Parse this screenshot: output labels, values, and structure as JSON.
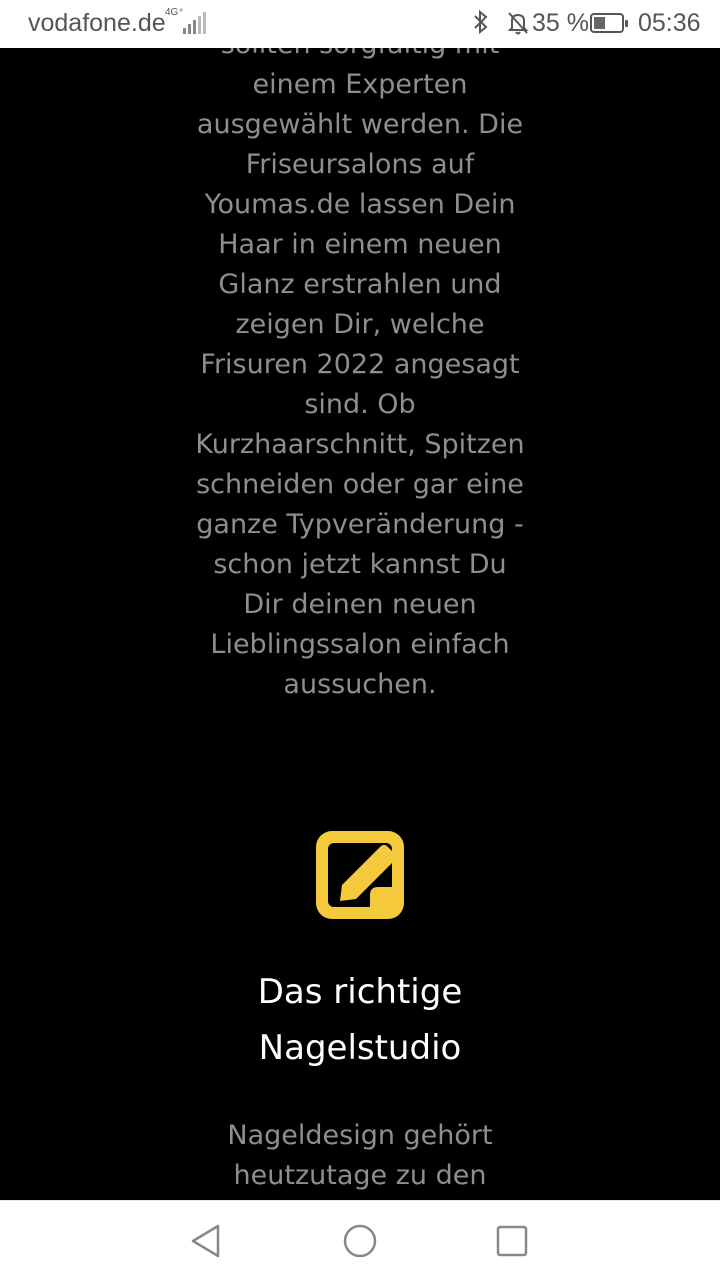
{
  "status_bar": {
    "carrier": "vodafone.de",
    "network": "4G⁺",
    "battery_percent": "35 %",
    "battery_level": 0.35,
    "time": "05:36",
    "icons": [
      "bluetooth-icon",
      "bell-off-icon",
      "battery-icon",
      "signal-icon"
    ]
  },
  "content": {
    "paragraph_1": "sollten sorgfältig mit einem Experten ausgewählt werden. Die Friseursalons auf Youmas.de lassen Dein Haar in einem neuen Glanz erstrahlen und zeigen Dir, welche Frisuren 2022 angesagt sind. Ob Kurzhaarschnitt, Spitzen schneiden oder gar eine ganze Typveränderung - schon jetzt kannst Du Dir deinen neuen Lieblingssalon einfach aussuchen.",
    "section_icon": "edit-icon",
    "icon_color": "#f5c93c",
    "heading": "Das richtige Nagelstudio",
    "paragraph_2": "Nageldesign gehört heutzutage zu den"
  },
  "nav_bar": {
    "icons": [
      "back-icon",
      "home-icon",
      "recent-apps-icon"
    ]
  }
}
